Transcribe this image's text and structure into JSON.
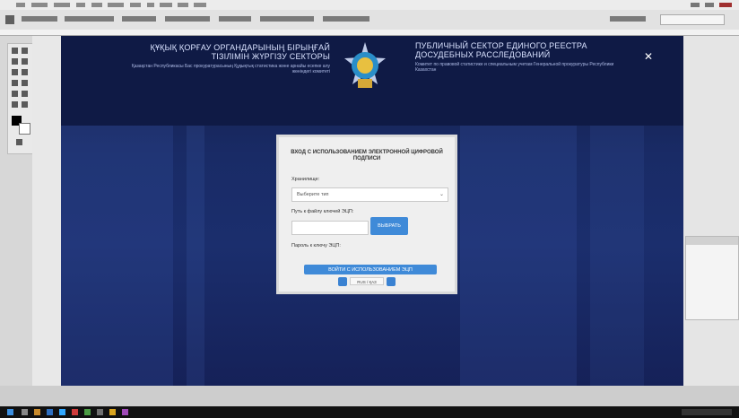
{
  "app": {
    "menu_items": [
      "Файл",
      "Редактирование",
      "Изображение",
      "Слои",
      "Текст",
      "Выделение",
      "Фильтр",
      "3D",
      "Просмотр",
      "Окно",
      "Справка"
    ],
    "window_controls": [
      "minimize",
      "maximize",
      "close"
    ]
  },
  "page_header": {
    "left_title": "ҚҰҚЫҚ ҚОРҒАУ ОРГАНДАРЫНЫҢ БІРЫҢҒАЙ ТІЗІЛІМІН ЖҮРГІЗУ СЕКТОРЫ",
    "left_subtitle": "Қазақстан Республикасы Бас прокуратурасының Құқықтық статистика және арнайы есепке алу жөніндегі комитеті",
    "right_title": "ПУБЛИЧНЫЙ СЕКТОР ЕДИНОГО РЕЕСТРА ДОСУДЕБНЫХ РАССЛЕДОВАНИЙ",
    "right_subtitle": "Комитет по правовой статистике и специальным учетам Генеральной прокуратуры Республики Казахстан",
    "close_symbol": "✕"
  },
  "modal": {
    "title": "ВХОД С ИСПОЛЬЗОВАНИЕМ ЭЛЕКТРОННОЙ ЦИФРОВОЙ ПОДПИСИ",
    "select_label": "Хранилище:",
    "select_value": "Выберите тип",
    "file_label": "Путь к файлу ключей ЭЦП:",
    "browse_button": "ВЫБРАТЬ",
    "password_label": "Пароль к ключу ЭЦП:",
    "submit_button": "ВОЙТИ С ИСПОЛЬЗОВАНИЕМ ЭЦП",
    "lang_label": "RUS / ҚАЗ"
  },
  "colors": {
    "canvas_bg": "#192b66",
    "accent": "#3f8ad8",
    "header_bg": "#0f1a45"
  },
  "icons": [
    "move-icon",
    "marquee-icon",
    "lasso-icon",
    "crop-icon",
    "brush-icon",
    "eraser-icon",
    "text-icon",
    "hand-icon",
    "zoom-icon",
    "emblem-icon",
    "close-icon",
    "dropdown-icon",
    "windows-start-icon"
  ]
}
